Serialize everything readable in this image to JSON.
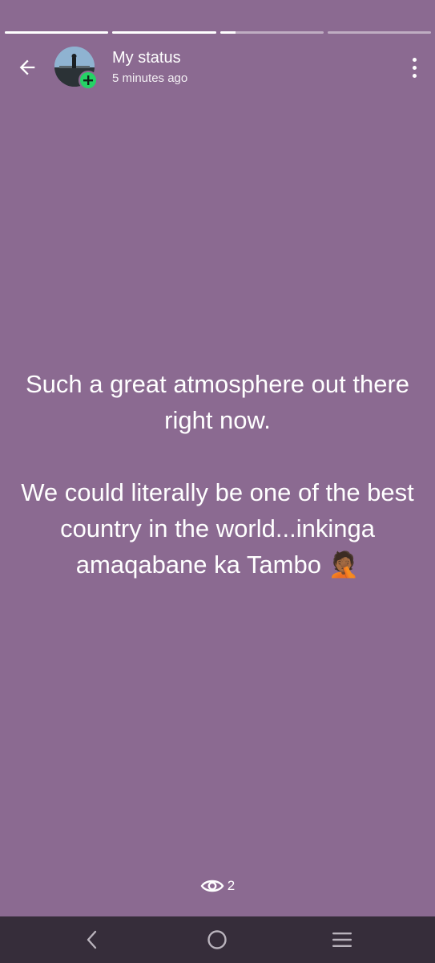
{
  "progress": [
    1,
    1,
    0.15,
    0
  ],
  "header": {
    "title": "My status",
    "subtitle": "5 minutes ago"
  },
  "status": {
    "paragraph1": "Such a great atmosphere out there right now.",
    "paragraph2": "We could literally be one of the best country in the world...inkinga amaqabane ka Tambo",
    "emoji": "🤦🏾"
  },
  "views": {
    "count": "2"
  },
  "colors": {
    "background": "#8b6a91",
    "navbar": "#362d3a",
    "add_badge": "#25d366"
  },
  "icons": {
    "back": "back-arrow-icon",
    "add": "plus-icon",
    "menu": "more-vertical-icon",
    "views": "eye-icon",
    "nav_back": "chevron-left-icon",
    "nav_home": "home-circle-icon",
    "nav_recents": "menu-lines-icon"
  }
}
